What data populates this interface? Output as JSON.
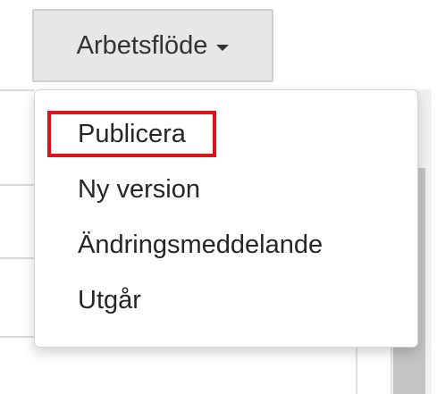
{
  "workflow_menu": {
    "button_label": "Arbetsflöde",
    "items": [
      {
        "label": "Publicera"
      },
      {
        "label": "Ny version"
      },
      {
        "label": "Ändringsmeddelande"
      },
      {
        "label": "Utgår"
      }
    ]
  },
  "colors": {
    "highlight_outline": "#e0131b",
    "button_background": "#e7e7e7",
    "text": "#262626"
  }
}
